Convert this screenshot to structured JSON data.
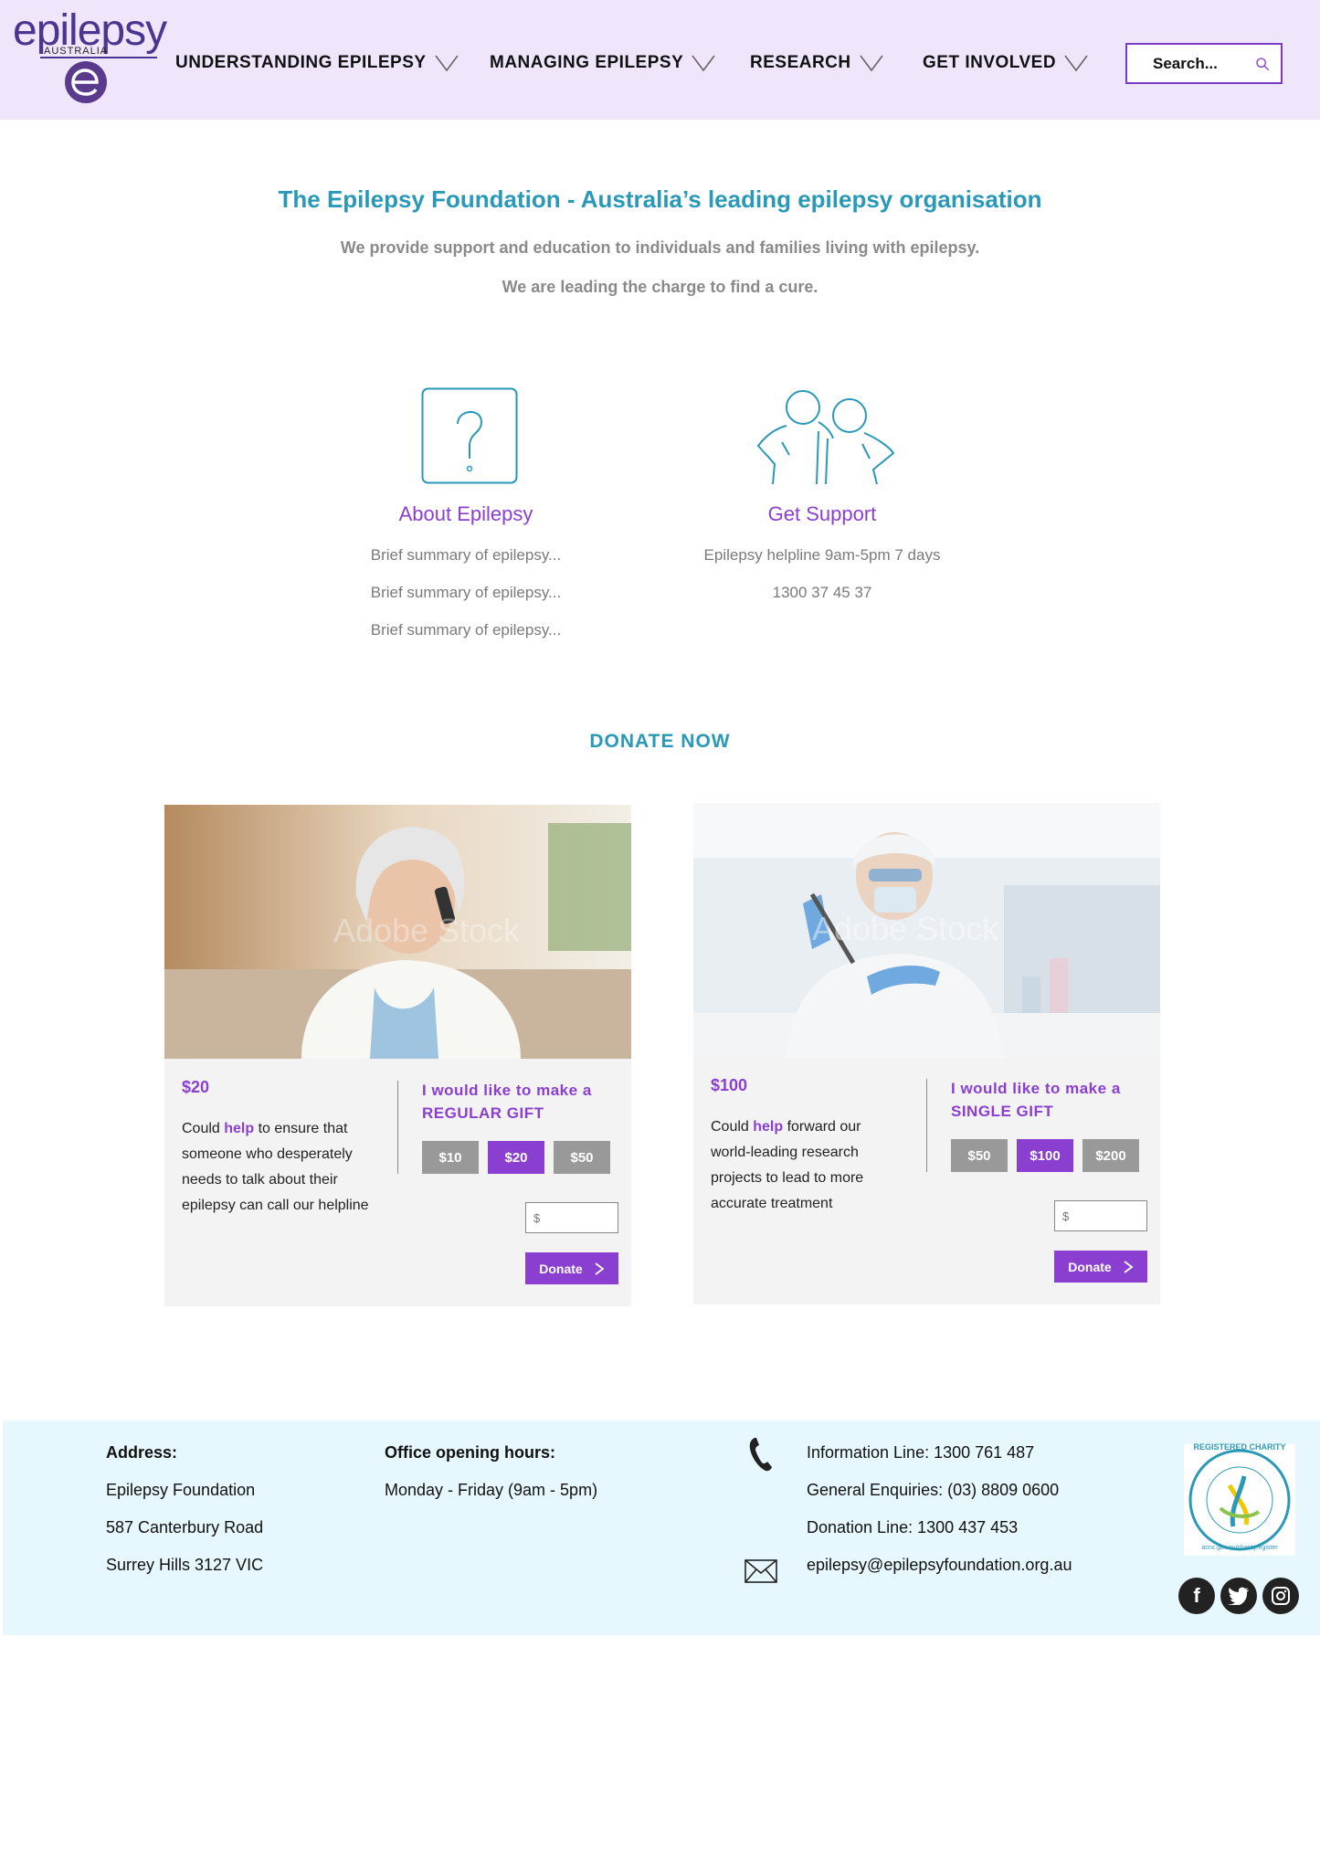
{
  "header": {
    "logo_text": "epilepsy",
    "logo_sub": "AUSTRALIA",
    "nav": [
      {
        "label": "UNDERSTANDING EPILEPSY"
      },
      {
        "label": "MANAGING EPILEPSY"
      },
      {
        "label": "RESEARCH"
      },
      {
        "label": "GET INVOLVED"
      }
    ],
    "search_placeholder": "Search..."
  },
  "intro": {
    "title": "The Epilepsy Foundation - Australia’s leading epilepsy organisation",
    "line1": "We provide support and education to individuals and families living with epilepsy.",
    "line2": "We are leading the charge to find a cure."
  },
  "features": [
    {
      "title": "About Epilepsy",
      "lines": [
        "Brief summary of epilepsy...",
        "Brief summary of epilepsy...",
        "Brief summary of epilepsy..."
      ]
    },
    {
      "title": "Get Support",
      "lines": [
        "Epilepsy helpline 9am-5pm 7 days",
        "1300 37 45 37"
      ]
    }
  ],
  "donate_heading": "DONATE NOW",
  "cards": [
    {
      "image_watermark": "Adobe Stock",
      "amount": "$20",
      "desc_pre": "Could ",
      "desc_hl": "help",
      "desc_post": " to ensure that someone who desperately needs to talk about their epilepsy can call our helpline",
      "gift_line1": "I would like to make a",
      "gift_line2": "REGULAR GIFT",
      "options": [
        "$10",
        "$20",
        "$50"
      ],
      "selected": "$20",
      "input_placeholder": "$",
      "donate_label": "Donate"
    },
    {
      "image_watermark": "Adobe Stock",
      "amount": "$100",
      "desc_pre": "Could ",
      "desc_hl": "help",
      "desc_post": " forward our world-leading research projects to lead to more accurate treatment",
      "gift_line1": "I would like to make a",
      "gift_line2": "SINGLE GIFT",
      "options": [
        "$50",
        "$100",
        "$200"
      ],
      "selected": "$100",
      "input_placeholder": "$",
      "donate_label": "Donate"
    }
  ],
  "footer": {
    "address_label": "Address:",
    "address_lines": [
      "Epilepsy Foundation",
      "587 Canterbury Road",
      "Surrey Hills 3127 VIC"
    ],
    "hours_label": "Office opening hours:",
    "hours": "Monday - Friday (9am - 5pm)",
    "phones": [
      "Information Line: 1300 761 487",
      "General Enquiries: (03) 8809 0600",
      "Donation Line: 1300 437 453"
    ],
    "email": "epilepsy@epilepsyfoundation.org.au",
    "charity_badge": "REGISTERED CHARITY",
    "charity_url": "acnc.gov.au/charityregister",
    "social": [
      "f",
      "t",
      "ig"
    ]
  },
  "colors": {
    "purple": "#8a3fd0",
    "teal": "#2a99b8",
    "header_bg": "#f0e6fb",
    "footer_bg": "#e6f8fd"
  }
}
